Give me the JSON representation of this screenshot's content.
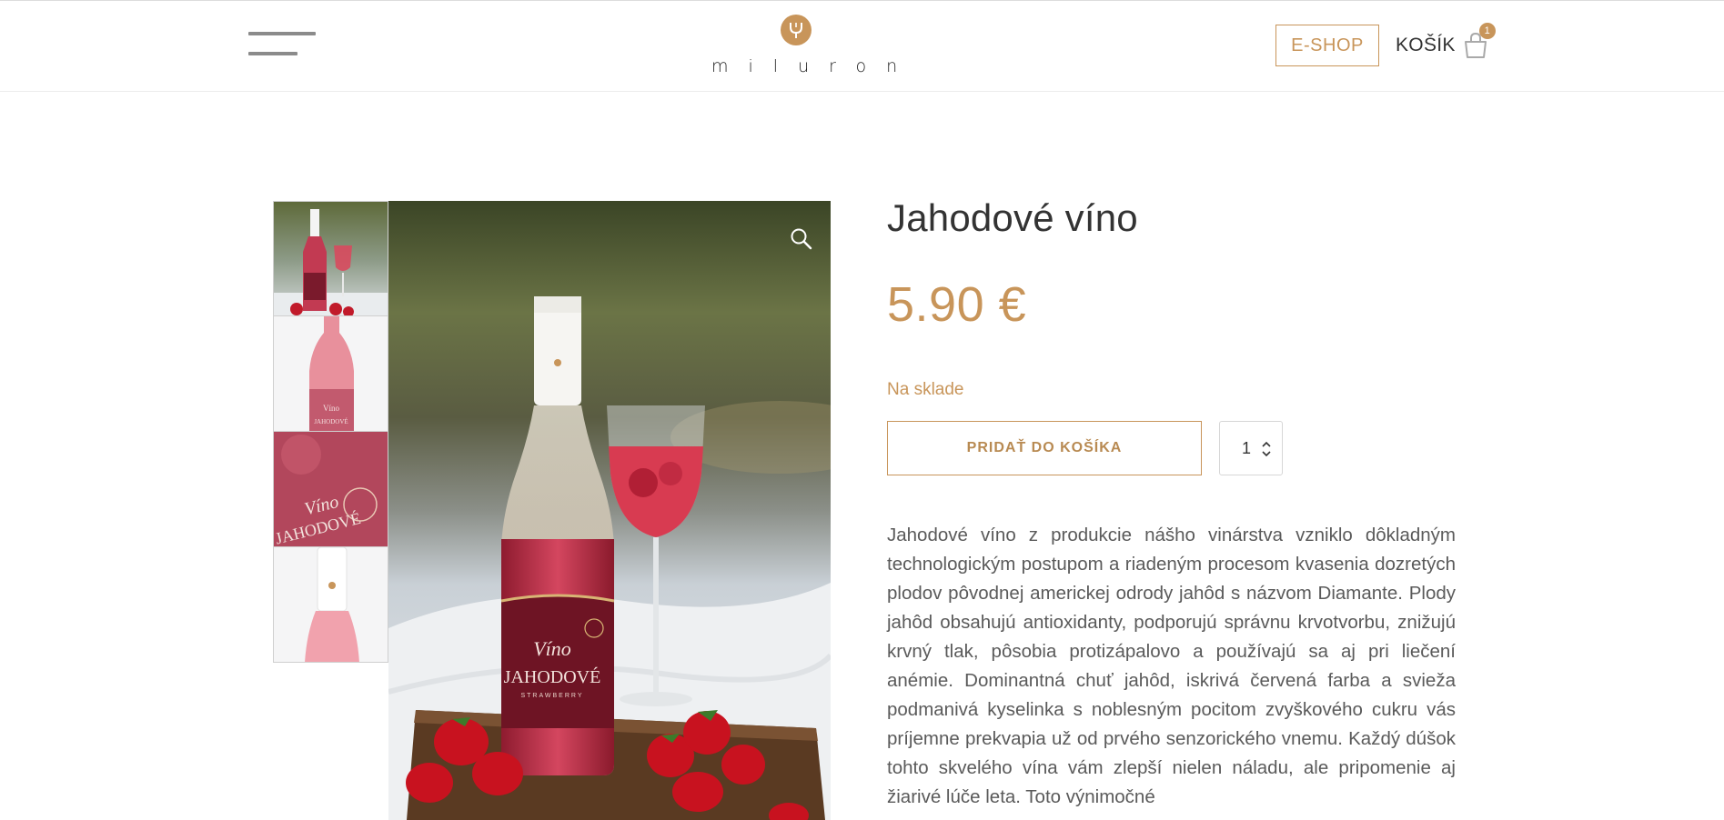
{
  "header": {
    "logo_text": "miluron",
    "eshop_label": "E-SHOP",
    "cart_label": "KOŠÍK",
    "cart_count": "1"
  },
  "gallery": {
    "thumb_count": 4
  },
  "product": {
    "title": "Jahodové víno",
    "price": "5.90 €",
    "stock": "Na sklade",
    "add_to_cart_label": "PRIDAŤ DO KOŠÍKA",
    "quantity": "1",
    "description": "Jahodové víno z produkcie nášho vinárstva vzniklo dôkladným technologickým postupom a riadeným procesom kvasenia dozretých plodov pôvodnej americkej odrody jahôd s názvom Diamante. Plody jahôd obsahujú antioxidanty, podporujú správnu krvotvorbu, znižujú krvný tlak, pôsobia protizápalovo a používajú sa aj pri liečení anémie. Dominantná chuť jahôd, iskrivá červená farba a svieža podmanivá kyselinka s noblesným pocitom zvyškového cukru vás príjemne prekvapia už od prvého senzorického vnemu. Každý dúšok tohto skvelého vína vám zlepší nielen náladu, ale pripomenie aj žiarivé lúče leta. Toto výnimočné"
  },
  "colors": {
    "accent": "#c8955a",
    "text": "#3a3a3a",
    "wine": "#b3223b"
  },
  "icons": {
    "menu": "hamburger-icon",
    "cart": "shopping-bag-icon",
    "zoom": "magnifier-icon"
  }
}
